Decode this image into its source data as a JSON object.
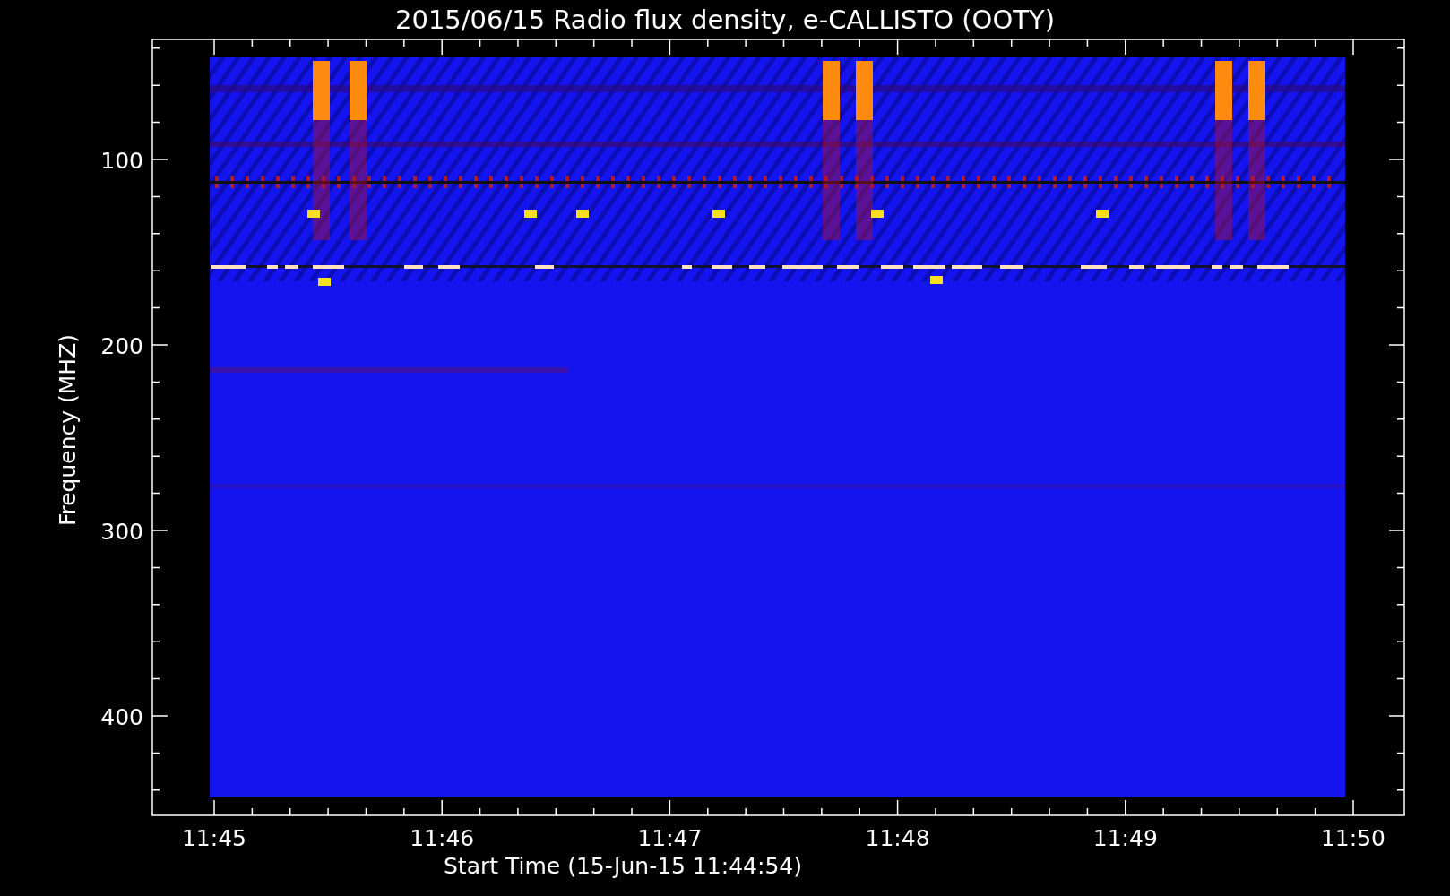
{
  "title": "2015/06/15  Radio flux density, e-CALLISTO (OOTY)",
  "y_axis": {
    "label": "Frequency (MHZ)",
    "ticks": [
      "100",
      "200",
      "300",
      "400"
    ]
  },
  "x_axis": {
    "label": "Start Time (15-Jun-15 11:44:54)",
    "ticks": [
      "11:45",
      "11:46",
      "11:47",
      "11:48",
      "11:49",
      "11:50"
    ]
  }
}
